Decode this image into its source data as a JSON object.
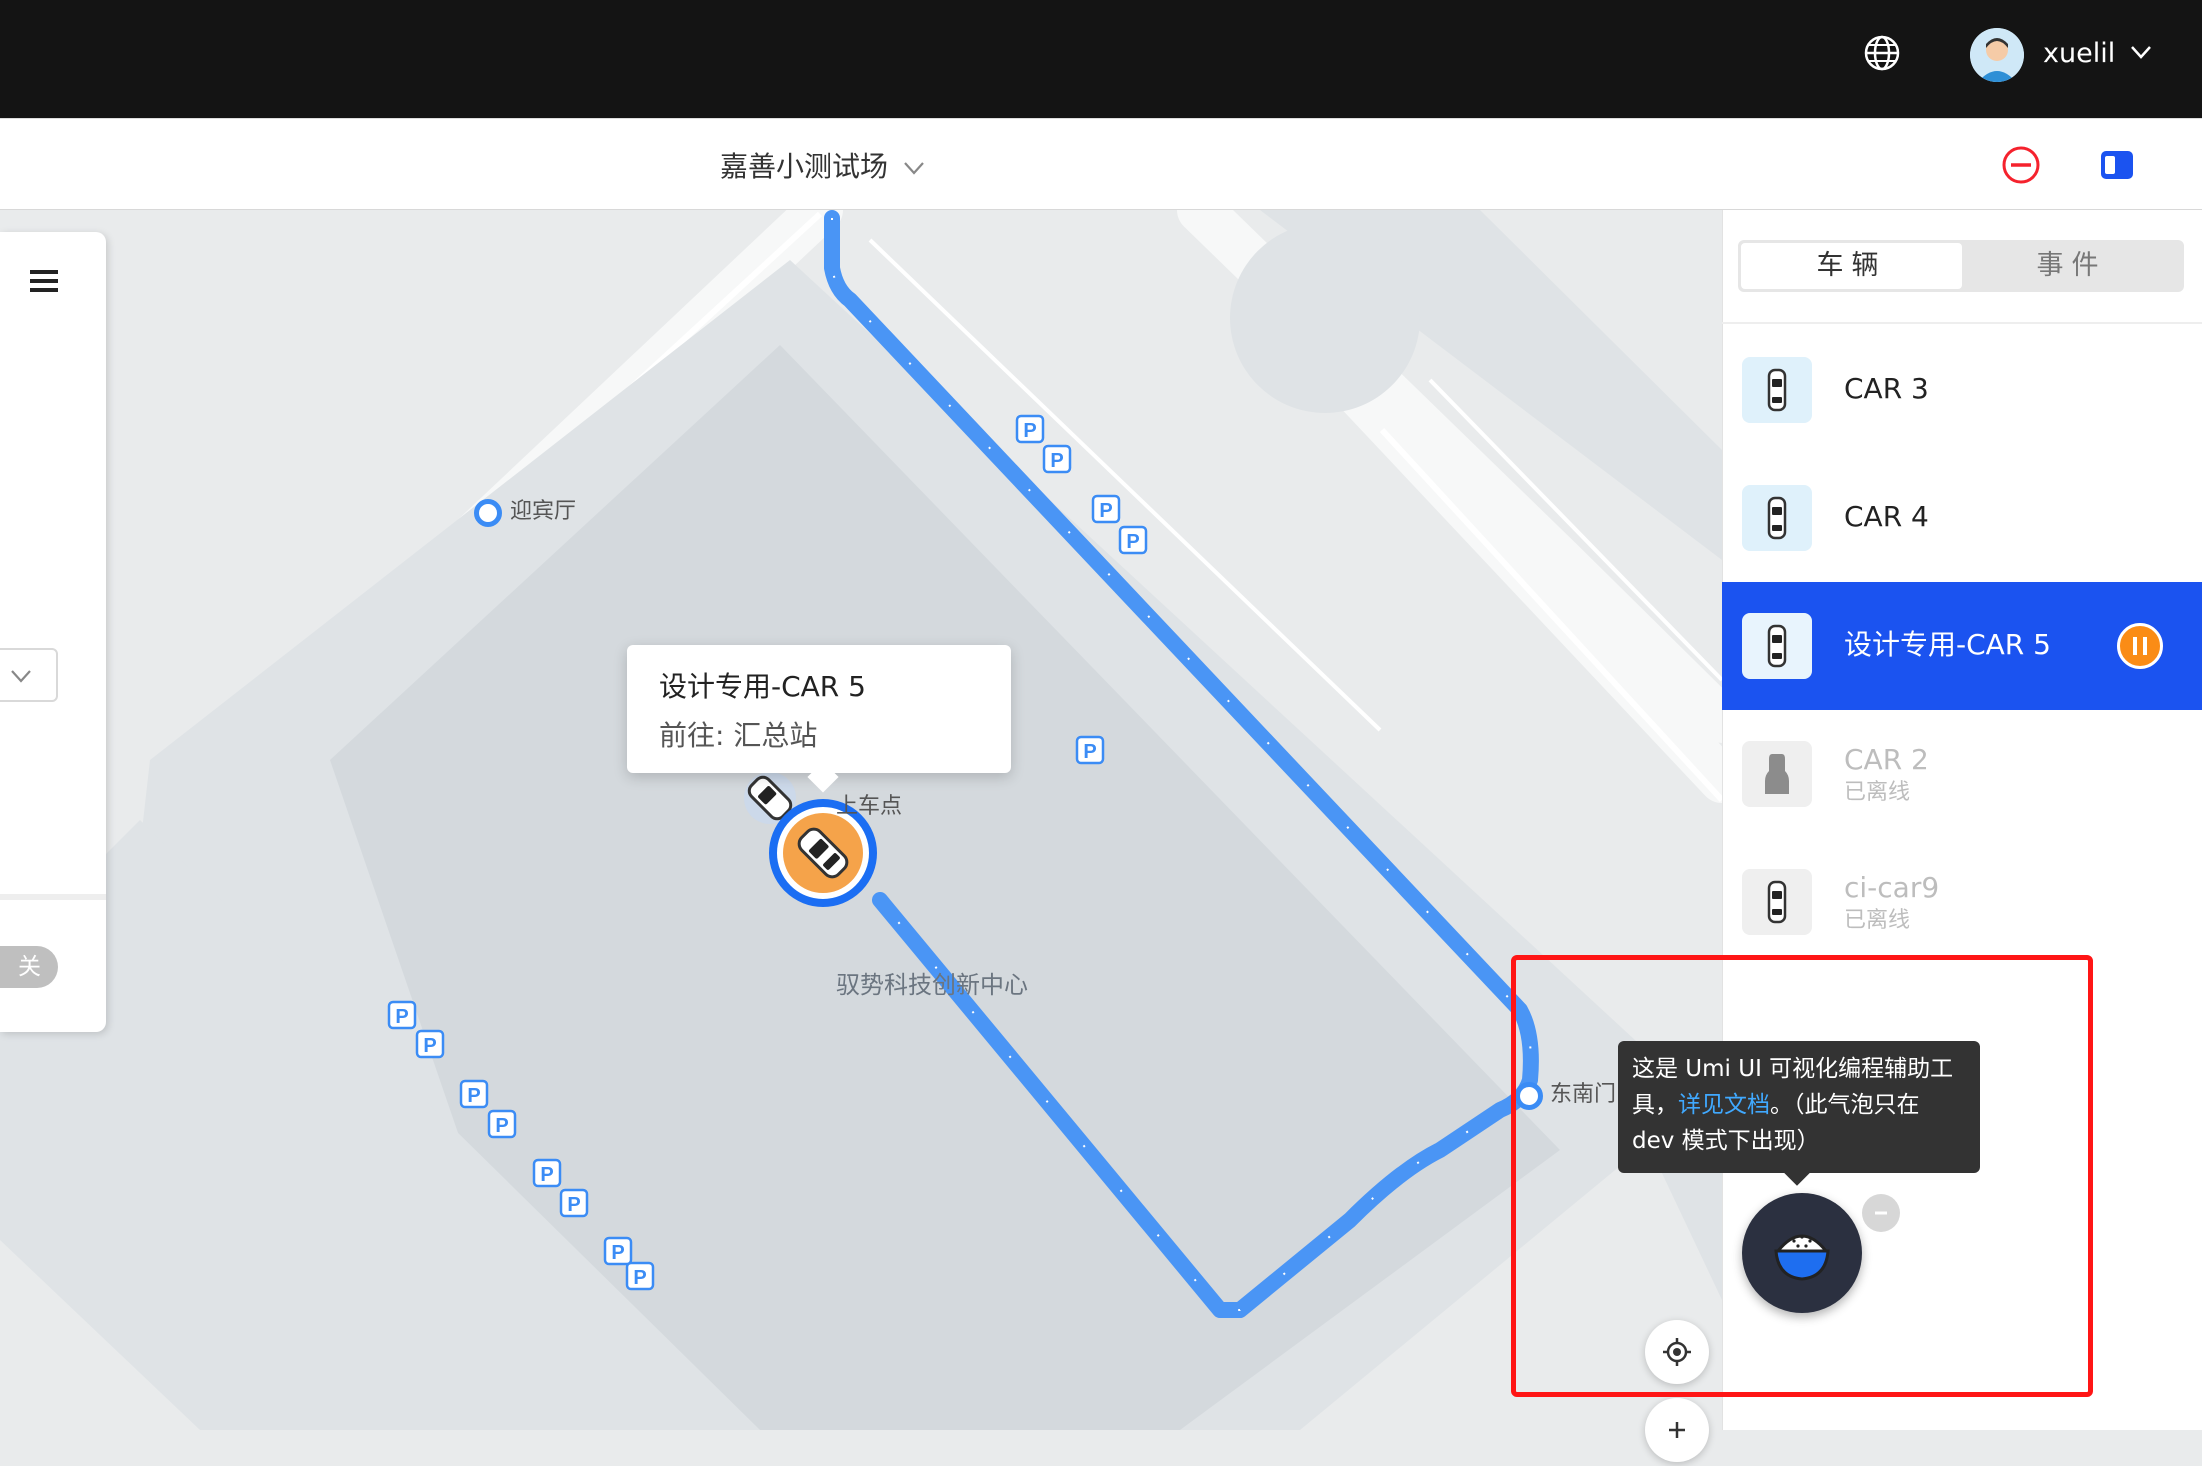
{
  "header": {
    "username": "xuelil",
    "icons": {
      "language": "globe-icon",
      "user_menu": "chevron-down-icon"
    }
  },
  "subheader": {
    "site_name": "嘉善小测试场",
    "icons": {
      "site_select": "chevron-down-icon",
      "stop": "stop-circle-icon",
      "layout": "panel-toggle-icon"
    }
  },
  "left_panel": {
    "menu_icon": "hamburger-menu-icon",
    "switch_label": "关"
  },
  "map": {
    "pois": [
      {
        "label": "迎宾厅"
      },
      {
        "label": "上车点"
      },
      {
        "label": "东南门"
      }
    ],
    "building_label": "驭势科技创新中心",
    "parking_symbol": "P",
    "popup": {
      "title": "设计专用-CAR 5",
      "destination": "前往: 汇总站"
    },
    "route_color": "#4a95f5",
    "icons": {
      "locate": "locate-icon",
      "zoom_in": "plus-icon"
    }
  },
  "right_panel": {
    "tabs": [
      {
        "label": "车辆",
        "active": true
      },
      {
        "label": "事件",
        "active": false
      }
    ],
    "vehicles": [
      {
        "name": "CAR 3",
        "status": "",
        "online": true,
        "selected": false
      },
      {
        "name": "CAR 4",
        "status": "",
        "online": true,
        "selected": false
      },
      {
        "name": "设计专用-CAR 5",
        "status": "",
        "online": true,
        "selected": true
      },
      {
        "name": "CAR 2",
        "status": "已离线",
        "online": false,
        "selected": false
      },
      {
        "name": "ci-car9",
        "status": "已离线",
        "online": false,
        "selected": false
      }
    ],
    "selected_color": "#1b53f0",
    "pause_color": "#fa8c16"
  },
  "umi_tooltip": {
    "text_before": "这是 Umi UI 可视化编程辅助工具，",
    "link": "详见文档",
    "text_after": "。（此气泡只在 dev 模式下出现）"
  },
  "highlight": {
    "color": "#ff1515"
  }
}
